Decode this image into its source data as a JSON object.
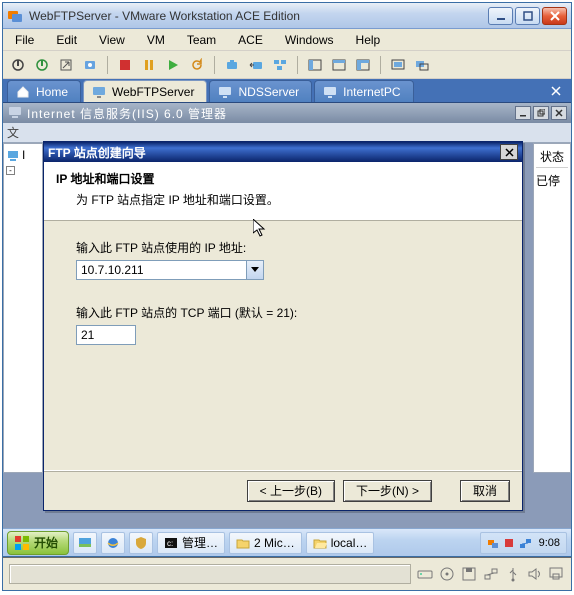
{
  "window": {
    "title": "WebFTPServer - VMware Workstation ACE Edition"
  },
  "menubar": [
    "File",
    "Edit",
    "View",
    "VM",
    "Team",
    "ACE",
    "Windows",
    "Help"
  ],
  "vmtabs": {
    "home": "Home",
    "items": [
      {
        "label": "WebFTPServer",
        "active": true
      },
      {
        "label": "NDSServer",
        "active": false
      },
      {
        "label": "InternetPC",
        "active": false
      }
    ]
  },
  "iis": {
    "title": "Internet 信息服务(IIS) 6.0 管理器",
    "menu_hint": "文",
    "status_header": "状态",
    "status_stopped": "已停"
  },
  "dialog": {
    "title": "FTP 站点创建向导",
    "header": "IP 地址和端口设置",
    "subheader": "为 FTP 站点指定 IP 地址和端口设置。",
    "ip_label": "输入此 FTP 站点使用的 IP 地址:",
    "ip_value": "10.7.10.211",
    "port_label": "输入此 FTP 站点的 TCP 端口 (默认 = 21):",
    "port_value": "21",
    "back": "< 上一步(B)",
    "next": "下一步(N) >",
    "cancel": "取消"
  },
  "guest_taskbar": {
    "start": "开始",
    "tasks": [
      {
        "label": "管理…"
      },
      {
        "label": "2 Mic…"
      },
      {
        "label": "local…"
      }
    ],
    "clock": "9:08"
  }
}
